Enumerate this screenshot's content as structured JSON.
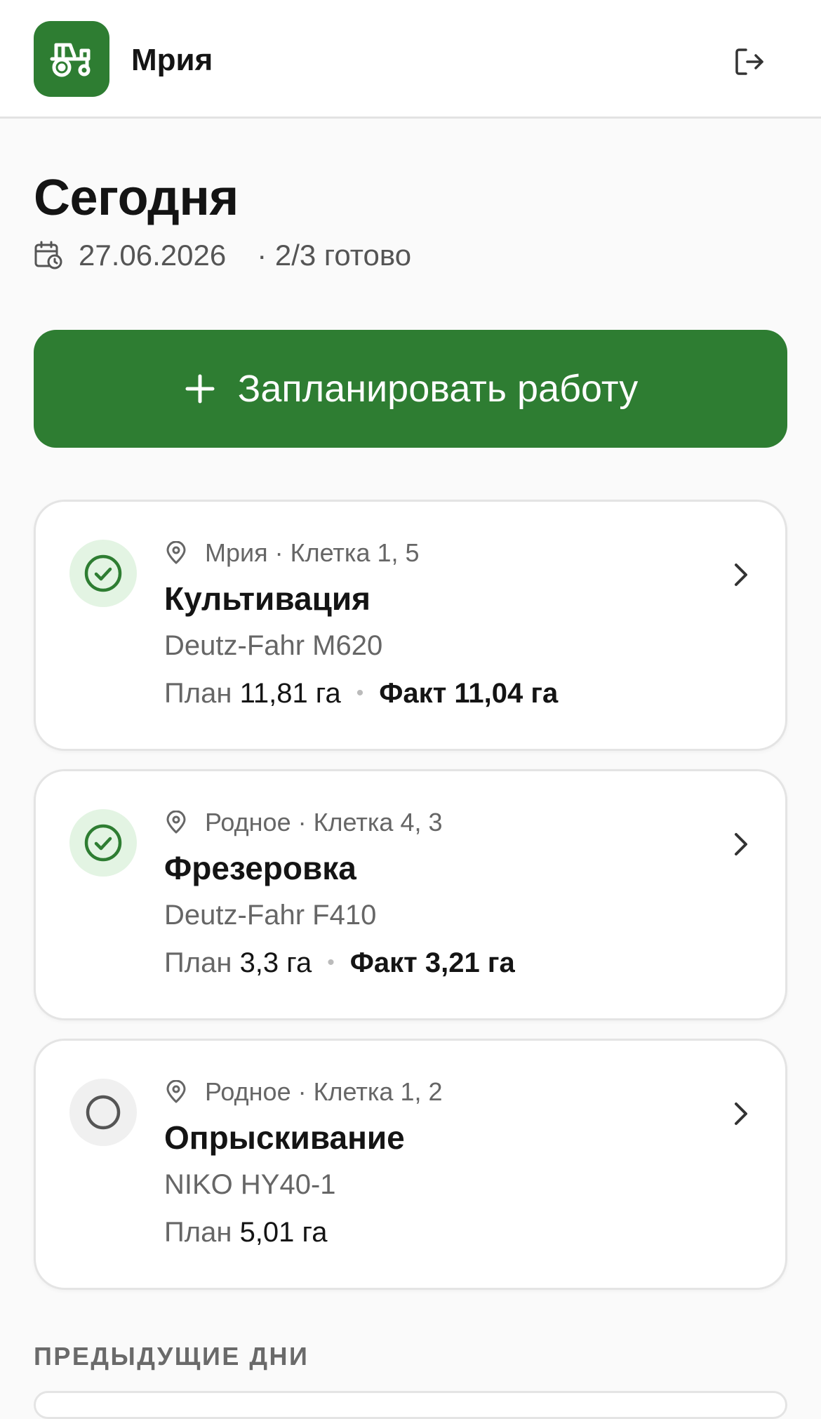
{
  "header": {
    "app_name": "Мрия",
    "logo_icon": "tractor-icon",
    "logout_icon": "logout-icon",
    "brand_color": "#2e7d32"
  },
  "page": {
    "title": "Сегодня",
    "date": "27.06.2026",
    "progress": "· 2/3 готово"
  },
  "actions": {
    "plan_work_label": "Запланировать работу"
  },
  "tasks": [
    {
      "status": "done",
      "location": "Мрия · Клетка 1, 5",
      "operation": "Культивация",
      "machine": "Deutz-Fahr M620",
      "plan_label": "План",
      "plan_value": "11,81 га",
      "fact": "Факт 11,04 га"
    },
    {
      "status": "done",
      "location": "Родное · Клетка 4, 3",
      "operation": "Фрезеровка",
      "machine": "Deutz-Fahr F410",
      "plan_label": "План",
      "plan_value": "3,3 га",
      "fact": "Факт 3,21 га"
    },
    {
      "status": "todo",
      "location": "Родное · Клетка 1, 2",
      "operation": "Опрыскивание",
      "machine": "NIKO HY40-1",
      "plan_label": "План",
      "plan_value": "5,01 га",
      "fact": ""
    }
  ],
  "previous": {
    "section_title": "ПРЕДЫДУЩИЕ ДНИ"
  }
}
